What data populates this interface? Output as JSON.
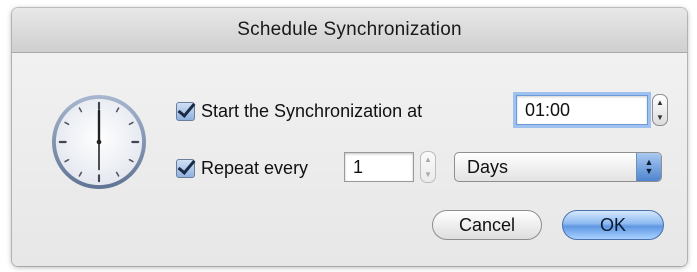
{
  "window": {
    "title": "Schedule Synchronization"
  },
  "start": {
    "checked": true,
    "label": "Start the Synchronization at",
    "time_value": "01:00"
  },
  "repeat": {
    "checked": true,
    "label": "Repeat every",
    "interval_value": "1",
    "unit_selected": "Days"
  },
  "buttons": {
    "cancel_label": "Cancel",
    "ok_label": "OK"
  },
  "icons": {
    "clock": "clock-icon",
    "stepper_up": "▲",
    "stepper_down": "▼"
  },
  "colors": {
    "accent": "#5f97e2",
    "dialog_bg": "#ececec"
  }
}
